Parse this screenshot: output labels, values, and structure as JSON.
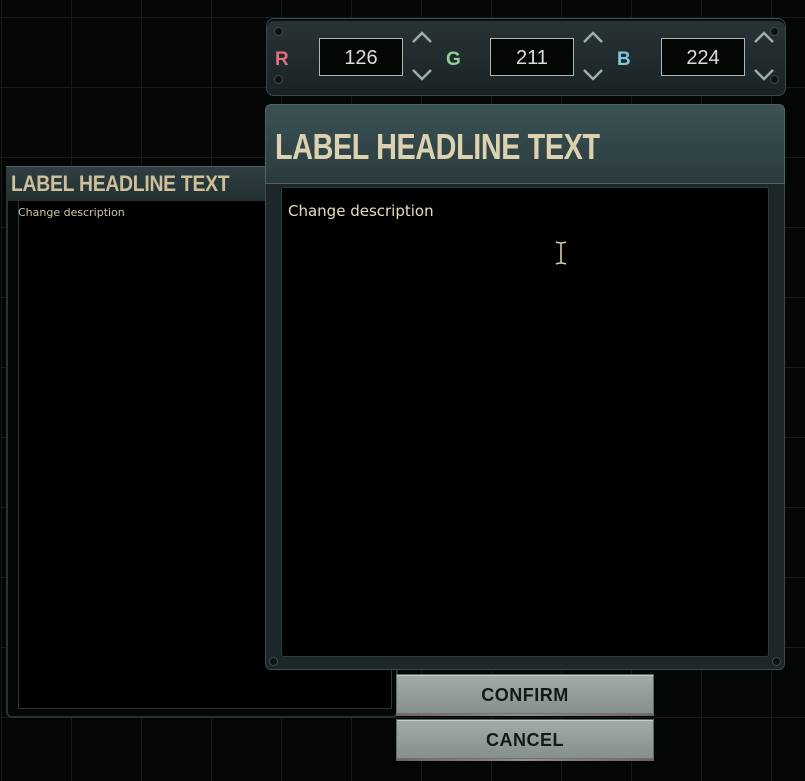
{
  "color_picker": {
    "channels": [
      {
        "label": "R",
        "value": "126",
        "color": "#e0707a"
      },
      {
        "label": "G",
        "value": "211",
        "color": "#8fcf8f"
      },
      {
        "label": "B",
        "value": "224",
        "color": "#7ec6de"
      }
    ]
  },
  "small_panel": {
    "title": "LABEL HEADLINE TEXT",
    "description": "Change description"
  },
  "editor_panel": {
    "title": "LABEL HEADLINE TEXT",
    "description": "Change description"
  },
  "buttons": {
    "confirm": "CONFIRM",
    "cancel": "CANCEL"
  },
  "icons": {
    "increment": "chevron-up-icon",
    "decrement": "chevron-down-icon",
    "cursor": "text-cursor-icon"
  }
}
